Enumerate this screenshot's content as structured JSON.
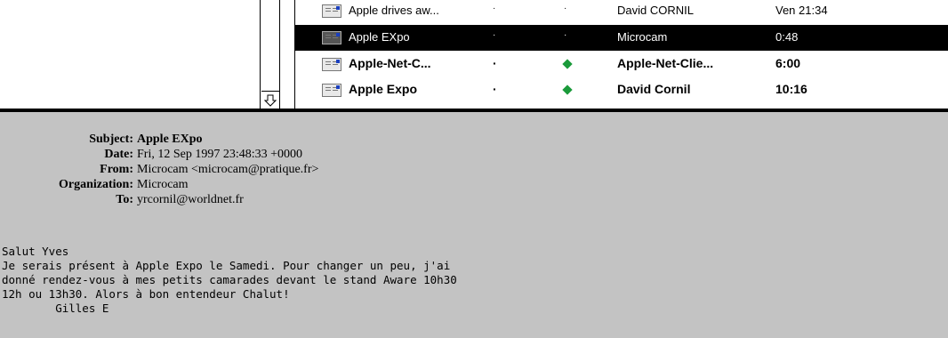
{
  "message_list": {
    "rows": [
      {
        "subject": "Apple drives aw...",
        "dot1": "·",
        "dot2": "·",
        "from": "David CORNIL",
        "date": "Ven 21:34",
        "selected": false,
        "bold": false,
        "flag": "none"
      },
      {
        "subject": "Apple EXpo",
        "dot1": "·",
        "dot2": "·",
        "from": "Microcam",
        "date": "0:48",
        "selected": true,
        "bold": false,
        "flag": "none"
      },
      {
        "subject": "Apple-Net-C...",
        "dot1": "·",
        "dot2": "",
        "from": "Apple-Net-Clie...",
        "date": "6:00",
        "selected": false,
        "bold": true,
        "flag": "green-diamond"
      },
      {
        "subject": "Apple Expo",
        "dot1": "·",
        "dot2": "",
        "from": "David Cornil",
        "date": "10:16",
        "selected": false,
        "bold": true,
        "flag": "green-diamond"
      }
    ]
  },
  "headers": {
    "subject_label": "Subject:",
    "subject_value": "Apple EXpo",
    "date_label": "Date:",
    "date_value": "Fri, 12 Sep 1997 23:48:33 +0000",
    "from_label": "From:",
    "from_value": "Microcam <microcam@pratique.fr>",
    "organization_label": "Organization:",
    "organization_value": "Microcam",
    "to_label": "To:",
    "to_value": "yrcornil@worldnet.fr"
  },
  "body": {
    "text": "Salut Yves\nJe serais présent à Apple Expo le Samedi. Pour changer un peu, j'ai\ndonné rendez-vous à mes petits camarades devant le stand Aware 10h30\n12h ou 13h30. Alors à bon entendeur Chalut!\n        Gilles E"
  },
  "colors": {
    "pane_background": "#c3c3c3",
    "selection": "#000000",
    "flag_green": "#1a9a3a"
  }
}
